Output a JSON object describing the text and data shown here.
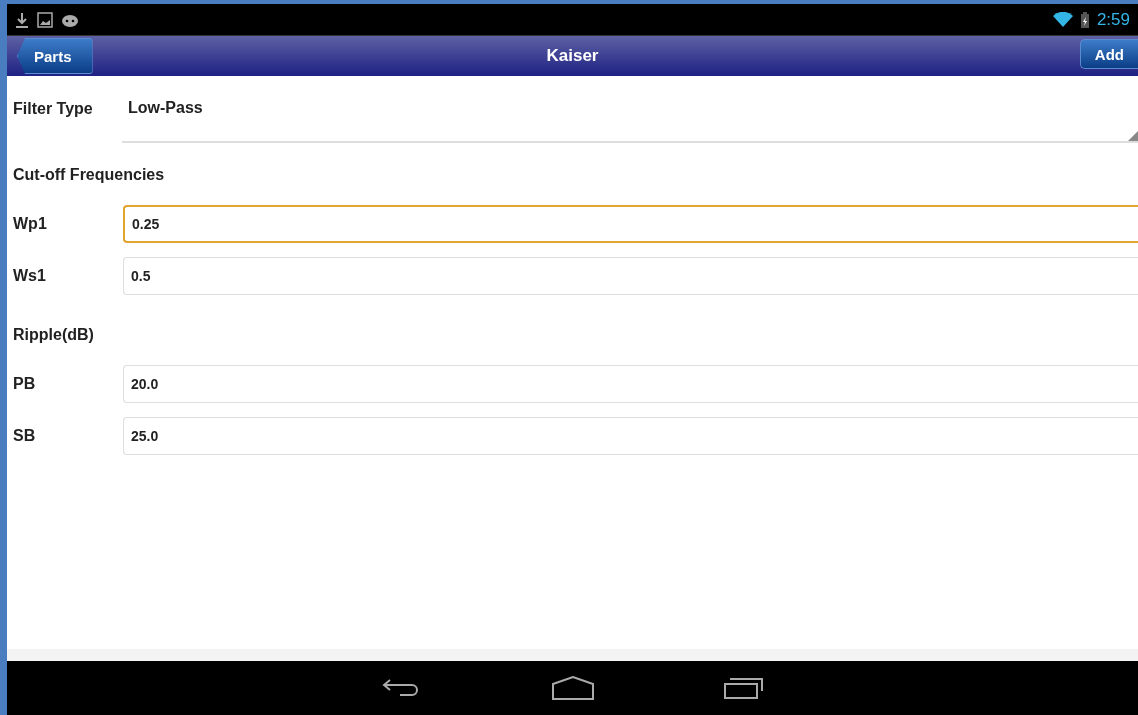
{
  "status_bar": {
    "time": "2:59"
  },
  "action_bar": {
    "back_button": "Parts",
    "title": "Kaiser",
    "action_button": "Add"
  },
  "filter": {
    "label": "Filter Type",
    "value": "Low-Pass"
  },
  "sections": [
    {
      "heading": "Cut-off Frequencies",
      "fields": [
        {
          "label": "Wp1",
          "value": "0.25",
          "focused": true
        },
        {
          "label": "Ws1",
          "value": "0.5",
          "focused": false
        }
      ]
    },
    {
      "heading": "Ripple(dB)",
      "fields": [
        {
          "label": "PB",
          "value": "20.0",
          "focused": false
        },
        {
          "label": "SB",
          "value": "25.0",
          "focused": false
        }
      ]
    }
  ]
}
